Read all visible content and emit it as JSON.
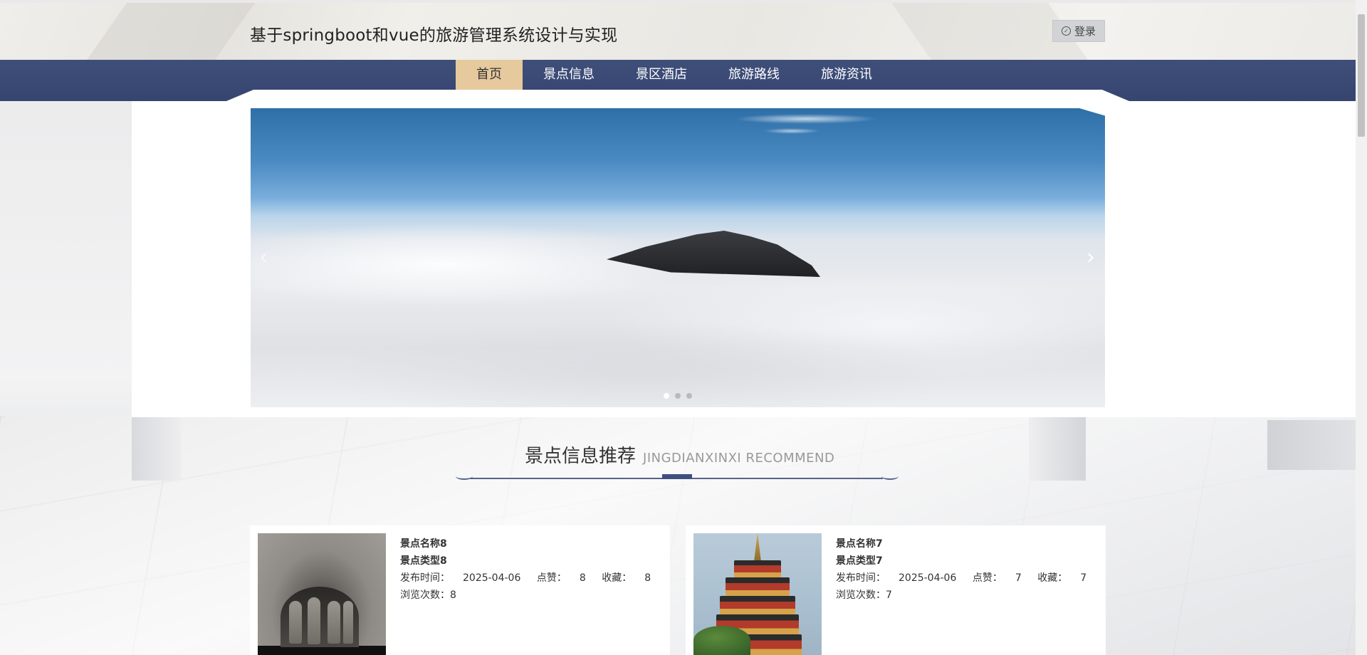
{
  "header": {
    "title": "基于springboot和vue的旅游管理系统设计与实现",
    "login_label": "登录"
  },
  "nav": {
    "items": [
      {
        "label": "首页",
        "active": true
      },
      {
        "label": "景点信息"
      },
      {
        "label": "景区酒店"
      },
      {
        "label": "旅游路线"
      },
      {
        "label": "旅游资讯"
      }
    ]
  },
  "carousel": {
    "slide_count": 3,
    "active_index": 0,
    "prev_icon": "chevron-left-icon",
    "next_icon": "chevron-right-icon"
  },
  "section": {
    "title_cn": "景点信息推荐",
    "title_en": "JINGDIANXINXI RECOMMEND"
  },
  "cards": [
    {
      "name": "景点名称8",
      "type": "景点类型8",
      "publish_label": "发布时间：",
      "publish_date": "2025-04-06",
      "likes_label": "点赞：",
      "likes": "8",
      "favorites_label": "收藏：",
      "favorites": "8",
      "views_label": "浏览次数：",
      "views": "8"
    },
    {
      "name": "景点名称7",
      "type": "景点类型7",
      "publish_label": "发布时间：",
      "publish_date": "2025-04-06",
      "likes_label": "点赞：",
      "likes": "7",
      "favorites_label": "收藏：",
      "favorites": "7",
      "views_label": "浏览次数：",
      "views": "7"
    }
  ],
  "colors": {
    "nav_bg": "#3f4f7a",
    "nav_active": "#e6c99c"
  }
}
